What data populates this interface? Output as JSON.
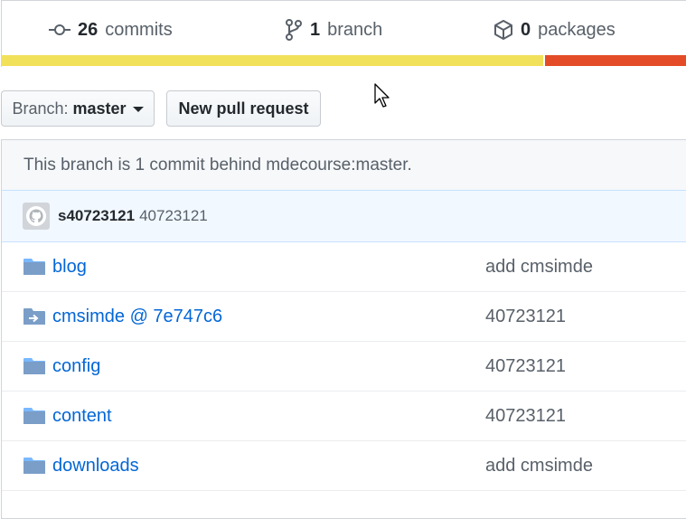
{
  "summary": {
    "commits": {
      "count": "26",
      "label": "commits",
      "icon": "commit-icon"
    },
    "branches": {
      "count": "1",
      "label": "branch",
      "icon": "branch-icon"
    },
    "packages": {
      "count": "0",
      "label": "packages",
      "icon": "package-icon"
    },
    "languages": [
      {
        "color": "#f1e05a",
        "percent": 78
      },
      {
        "color": "#e34c26",
        "percent": 22
      }
    ]
  },
  "toolbar": {
    "branch_prefix": "Branch:",
    "branch_name": "master",
    "new_pr_label": "New pull request"
  },
  "notice": "This branch is 1 commit behind mdecourse:master.",
  "latest_commit": {
    "avatar_icon": "github-avatar-icon",
    "author": "s40723121",
    "message": "40723121"
  },
  "files": [
    {
      "name": "blog",
      "icon": "folder-icon",
      "message": "add cmsimde"
    },
    {
      "name": "cmsimde @ 7e747c6",
      "icon": "submodule-icon",
      "message": "40723121"
    },
    {
      "name": "config",
      "icon": "folder-icon",
      "message": "40723121"
    },
    {
      "name": "content",
      "icon": "folder-icon",
      "message": "40723121"
    },
    {
      "name": "downloads",
      "icon": "folder-icon",
      "message": "add cmsimde"
    }
  ]
}
